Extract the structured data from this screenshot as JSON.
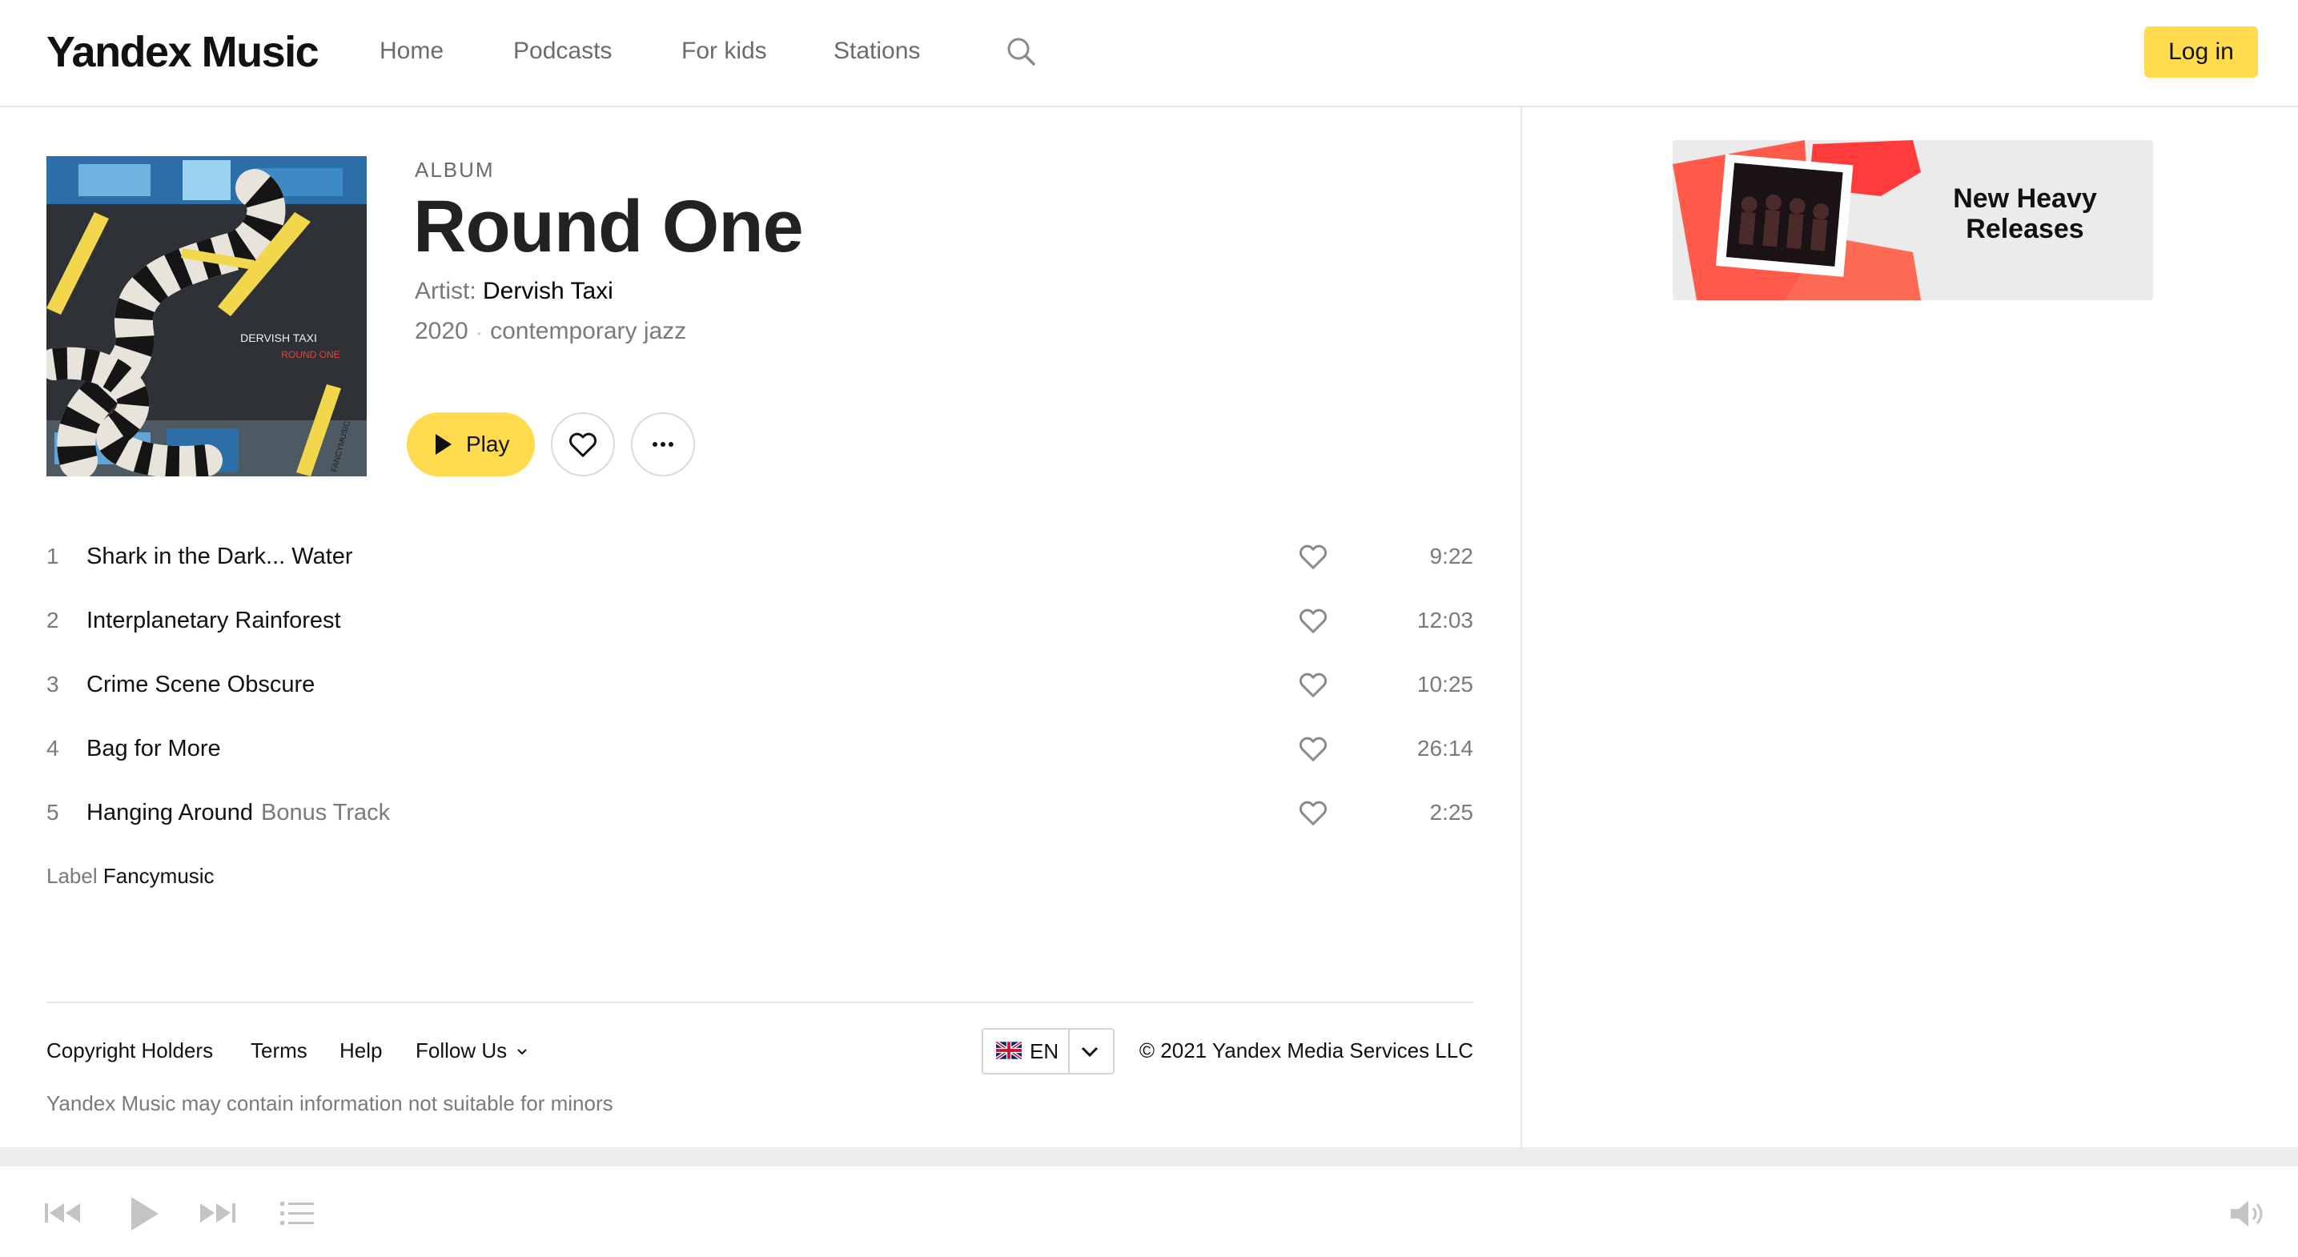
{
  "header": {
    "logo": "Yandex Music",
    "nav": [
      "Home",
      "Podcasts",
      "For kids",
      "Stations"
    ],
    "login_label": "Log in"
  },
  "album": {
    "kind": "ALBUM",
    "title": "Round One",
    "artist_prefix": "Artist:",
    "artist": "Dervish Taxi",
    "year": "2020",
    "genre": "contemporary jazz",
    "cover_text_artist": "DERVISH TAXI",
    "cover_text_title": "ROUND ONE",
    "cover_text_label": "FANCYMUSIC",
    "play_label": "Play"
  },
  "tracks": [
    {
      "num": "1",
      "title": "Shark in the Dark... Water",
      "extra": "",
      "duration": "9:22"
    },
    {
      "num": "2",
      "title": "Interplanetary Rainforest",
      "extra": "",
      "duration": "12:03"
    },
    {
      "num": "3",
      "title": "Crime Scene Obscure",
      "extra": "",
      "duration": "10:25"
    },
    {
      "num": "4",
      "title": "Bag for More",
      "extra": "",
      "duration": "26:14"
    },
    {
      "num": "5",
      "title": "Hanging Around",
      "extra": "Bonus Track",
      "duration": "2:25"
    }
  ],
  "label": {
    "prefix": "Label",
    "value": "Fancymusic"
  },
  "footer": {
    "links": [
      "Copyright Holders",
      "Terms",
      "Help",
      "Follow Us"
    ],
    "language": "EN",
    "copyright": "© 2021 Yandex Media Services LLC",
    "disclaimer": "Yandex Music may contain information not suitable for minors"
  },
  "promo": {
    "line1": "New Heavy",
    "line2": "Releases"
  },
  "icons": {
    "search": "search-icon",
    "like": "heart-icon",
    "more": "more-dots-icon",
    "prev": "previous-track-icon",
    "play": "play-icon",
    "next": "next-track-icon",
    "queue": "playlist-icon",
    "volume": "volume-icon",
    "flag": "uk-flag-icon"
  },
  "colors": {
    "accent": "#ffdb4d",
    "text": "#111111",
    "muted": "#7a7a7a",
    "promo_red": "#ff5a4a"
  }
}
